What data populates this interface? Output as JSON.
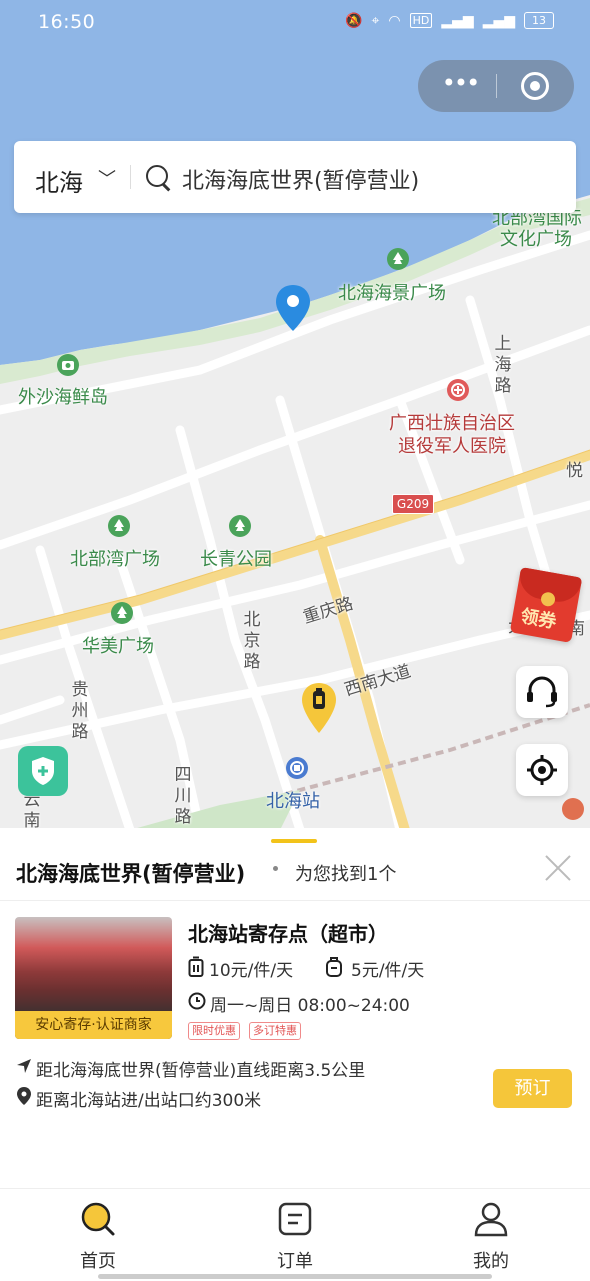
{
  "status_bar": {
    "time": "16:50",
    "network": "HD",
    "battery": "13"
  },
  "search": {
    "city": "北海",
    "query": "北海海底世界(暂停营业)"
  },
  "map_labels": {
    "haiguo": "北部湾国际",
    "haiguo2": "文化广场",
    "haijing": "北海海景广场",
    "waisha": "外沙海鲜岛",
    "shanghai_road": "上海路",
    "hospital1": "广西壮族自治区",
    "hospital2": "退役军人医院",
    "yue": "悦",
    "g209": "G209",
    "beibuwan": "北部湾广场",
    "changqing": "长青公园",
    "chongqing": "重庆路",
    "huamei": "华美广场",
    "beijing_road": "北京路",
    "xinan": "西南大道",
    "guizhou": "贵州路",
    "sichuan": "四川路",
    "station": "北海站",
    "yunnan": "云南",
    "da": "大",
    "right_char": "南"
  },
  "coupon": {
    "label": "领券"
  },
  "sheet": {
    "title": "北海海底世界(暂停营业)",
    "found": "为您找到1个",
    "store": {
      "name": "北海站寄存点（超市）",
      "badge": "安心寄存·认证商家",
      "price_luggage": "10元/件/天",
      "price_bag": "5元/件/天",
      "hours": "周一~周日 08:00~24:00",
      "tag1": "限时优惠",
      "tag2": "多订特惠",
      "distance": "距北海海底世界(暂停营业)直线距离3.5公里",
      "station": "距离北海站进/出站口约300米",
      "book": "预订"
    }
  },
  "tabs": [
    {
      "label": "首页",
      "icon": "search-home-icon",
      "active": true
    },
    {
      "label": "订单",
      "icon": "order-icon",
      "active": false
    },
    {
      "label": "我的",
      "icon": "profile-icon",
      "active": false
    }
  ],
  "colors": {
    "accent": "#f5c63a",
    "water": "#8fb6e6",
    "road_yellow": "#f6d98a",
    "park_green": "#3a8a4a"
  }
}
